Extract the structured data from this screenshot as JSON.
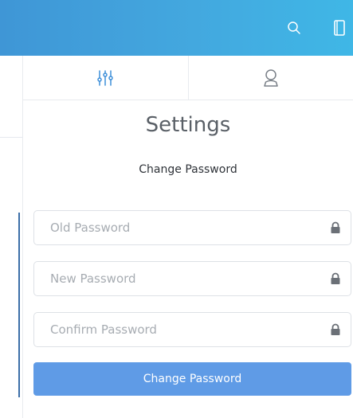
{
  "topbar": {
    "search_icon": "search-icon",
    "panel_icon": "panel-toggle-icon",
    "gradient": [
      "#3f96d6",
      "#3fb7e6"
    ]
  },
  "tabs": [
    {
      "icon": "sliders-icon",
      "active": true
    },
    {
      "icon": "user-icon",
      "active": false
    }
  ],
  "settings": {
    "title": "Settings",
    "section_title": "Change Password"
  },
  "form": {
    "old_password_placeholder": "Old Password",
    "new_password_placeholder": "New Password",
    "confirm_password_placeholder": "Confirm Password",
    "submit_label": "Change Password",
    "lock_icon": "lock-icon"
  },
  "colors": {
    "accent": "#5f9be6",
    "tab_icon_active": "#3d8fd9",
    "tab_icon_inactive": "#7a8088"
  }
}
